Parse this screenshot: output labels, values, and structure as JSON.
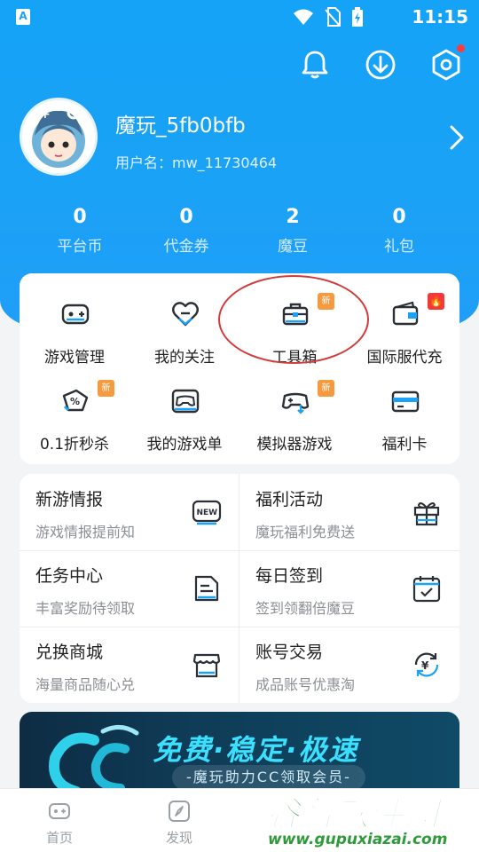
{
  "status_bar": {
    "time": "11:15",
    "app_icon": "A"
  },
  "header": {
    "icons": [
      "bell-icon",
      "download-icon",
      "settings-icon"
    ]
  },
  "profile": {
    "nickname": "魔玩_5fb0bfb",
    "user_id": "用户名：mw_11730464"
  },
  "stats": [
    {
      "value": "0",
      "label": "平台币"
    },
    {
      "value": "0",
      "label": "代金券"
    },
    {
      "value": "2",
      "label": "魔豆"
    },
    {
      "value": "0",
      "label": "礼包"
    }
  ],
  "grid": {
    "row1": [
      {
        "label": "游戏管理",
        "icon": "gamepad-icon",
        "badge": ""
      },
      {
        "label": "我的关注",
        "icon": "heart-icon",
        "badge": ""
      },
      {
        "label": "工具箱",
        "icon": "toolbox-icon",
        "badge": "新"
      },
      {
        "label": "国际服代充",
        "icon": "wallet-icon",
        "badge": "hot"
      }
    ],
    "row2": [
      {
        "label": "0.1折秒杀",
        "icon": "discount-tag-icon",
        "badge": "新"
      },
      {
        "label": "我的游戏单",
        "icon": "controller-icon",
        "badge": ""
      },
      {
        "label": "模拟器游戏",
        "icon": "joystick-download-icon",
        "badge": "新"
      },
      {
        "label": "福利卡",
        "icon": "card-icon",
        "badge": ""
      }
    ]
  },
  "list": [
    {
      "title": "新游情报",
      "sub": "游戏情报提前知",
      "icon": "new-icon"
    },
    {
      "title": "福利活动",
      "sub": "魔玩福利免费送",
      "icon": "gift-icon"
    },
    {
      "title": "任务中心",
      "sub": "丰富奖励待领取",
      "icon": "task-icon"
    },
    {
      "title": "每日签到",
      "sub": "签到领翻倍魔豆",
      "icon": "calendar-icon"
    },
    {
      "title": "兑换商城",
      "sub": "海量商品随心兑",
      "icon": "shop-icon"
    },
    {
      "title": "账号交易",
      "sub": "成品账号优惠淘",
      "icon": "yen-exchange-icon"
    }
  ],
  "banner": {
    "title": "免费·稳定·极速",
    "subtitle": "-魔玩助力CC领取会员-"
  },
  "bottom_nav": [
    {
      "label": "首页",
      "icon": "home-gamepad-icon"
    },
    {
      "label": "发现",
      "icon": "compass-icon"
    }
  ],
  "watermark": {
    "name": "谷普软件园",
    "url": "www.gupuxiazai.com"
  },
  "colors": {
    "primary": "#1aa2f6",
    "badge_new": "#f59a3e",
    "badge_hot": "#f23a3a",
    "annotation": "#d33a3a"
  }
}
